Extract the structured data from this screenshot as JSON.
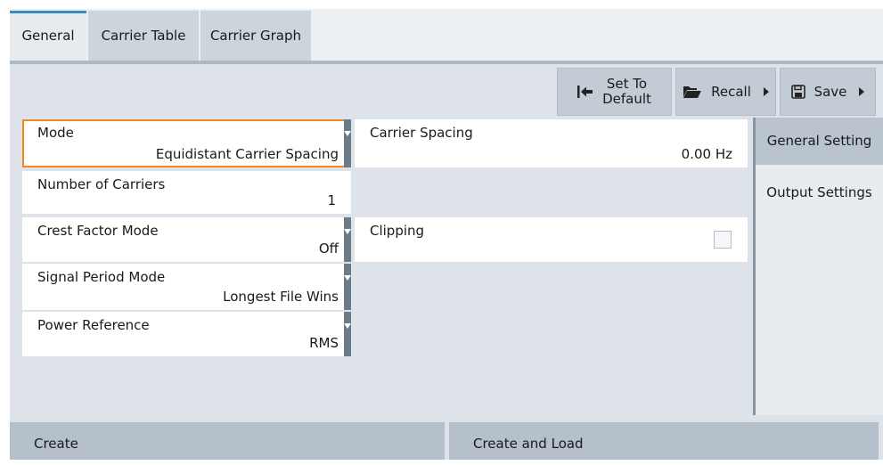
{
  "tabs": [
    {
      "label": "General"
    },
    {
      "label": "Carrier Table"
    },
    {
      "label": "Carrier Graph"
    }
  ],
  "toolbar": {
    "set_default_line1": "Set To",
    "set_default_line2": "Default",
    "recall_label": "Recall",
    "save_label": "Save"
  },
  "fields": {
    "mode": {
      "label": "Mode",
      "value": "Equidistant Carrier Spacing"
    },
    "carrier_spacing": {
      "label": "Carrier Spacing",
      "value": "0.00 Hz"
    },
    "number_of_carriers": {
      "label": "Number of Carriers",
      "value": "1"
    },
    "crest_factor_mode": {
      "label": "Crest Factor Mode",
      "value": "Off"
    },
    "clipping": {
      "label": "Clipping",
      "checked": false
    },
    "signal_period_mode": {
      "label": "Signal Period Mode",
      "value": "Longest File Wins"
    },
    "power_reference": {
      "label": "Power Reference",
      "value": "RMS"
    }
  },
  "side_tabs": [
    {
      "label": "General Setting",
      "active": true
    },
    {
      "label": "Output Settings",
      "active": false
    }
  ],
  "bottom": {
    "create_label": "Create",
    "create_and_load_label": "Create and Load"
  },
  "colors": {
    "accent": "#3b8dc8",
    "focus": "#f08a1c"
  }
}
